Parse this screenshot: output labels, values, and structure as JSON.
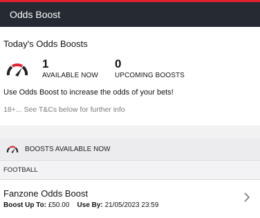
{
  "header": {
    "title": "Odds Boost"
  },
  "summary": {
    "title": "Today's Odds Boosts",
    "available_count": "1",
    "available_label": "AVAILABLE NOW",
    "upcoming_count": "0",
    "upcoming_label": "UPCOMING BOOSTS",
    "description": "Use Odds Boost to increase the odds of your bets!",
    "terms": "18+... See T&Cs below for further info"
  },
  "boosts_section": {
    "label": "BOOSTS AVAILABLE NOW",
    "icon": "speedometer-icon"
  },
  "category": {
    "label": "FOOTBALL"
  },
  "boost_item": {
    "title": "Fanzone Odds Boost",
    "boost_up_to_label": "Boost Up To:",
    "boost_up_to_value": "£50.00",
    "use_by_label": "Use By:",
    "use_by_value": "21/05/2023 23:59"
  },
  "colors": {
    "accent_red": "#e4202c",
    "header_bg": "#262a33"
  }
}
